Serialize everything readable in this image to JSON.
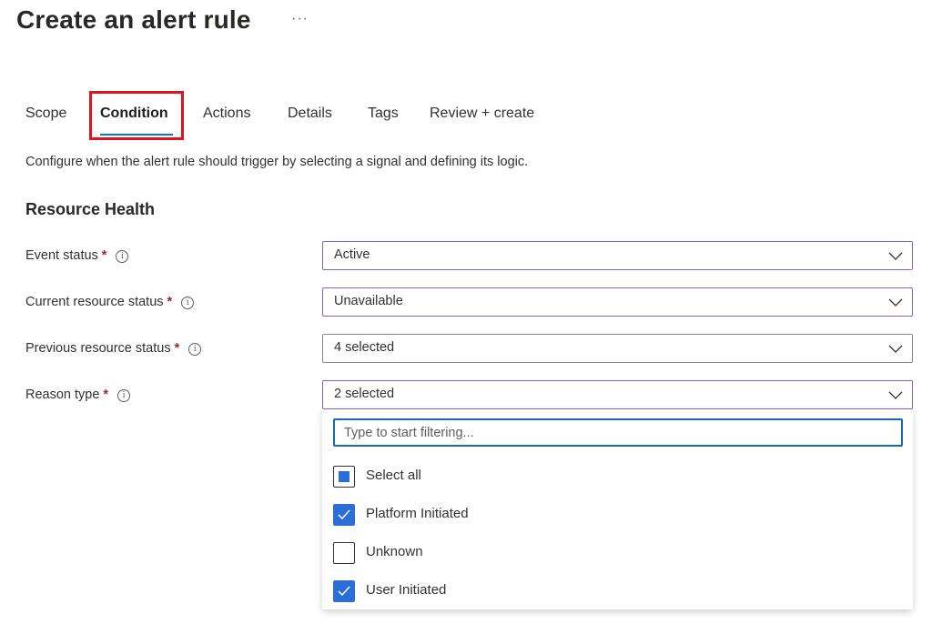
{
  "page": {
    "title": "Create an alert rule",
    "more_label": "···"
  },
  "tabs": [
    {
      "label": "Scope",
      "active": false
    },
    {
      "label": "Condition",
      "active": true
    },
    {
      "label": "Actions",
      "active": false
    },
    {
      "label": "Details",
      "active": false
    },
    {
      "label": "Tags",
      "active": false
    },
    {
      "label": "Review + create",
      "active": false
    }
  ],
  "description": "Configure when the alert rule should trigger by selecting a signal and defining its logic.",
  "section": {
    "title": "Resource Health"
  },
  "fields": [
    {
      "label": "Event status",
      "required_mark": "*",
      "info_glyph": "i",
      "value": "Active"
    },
    {
      "label": "Current resource status",
      "required_mark": "*",
      "info_glyph": "i",
      "value": "Unavailable"
    },
    {
      "label": "Previous resource status",
      "required_mark": "*",
      "info_glyph": "i",
      "value": "4 selected"
    },
    {
      "label": "Reason type",
      "required_mark": "*",
      "info_glyph": "i",
      "value": "2 selected"
    }
  ],
  "reason_dropdown": {
    "filter_placeholder": "Type to start filtering...",
    "options": [
      {
        "label": "Select all",
        "state": "partial"
      },
      {
        "label": "Platform Initiated",
        "state": "checked"
      },
      {
        "label": "Unknown",
        "state": "unchecked"
      },
      {
        "label": "User Initiated",
        "state": "checked"
      }
    ]
  },
  "colors": {
    "accent": "#0078d4",
    "checkbox": "#2b6fd6",
    "highlight_border": "#e0141e",
    "required": "#a4262c",
    "focused_dropdown_border": "#8661c5"
  },
  "icons": {
    "more": "more-horizontal-icon",
    "info": "info-icon",
    "chevron": "chevron-down-icon",
    "check": "check-icon"
  }
}
